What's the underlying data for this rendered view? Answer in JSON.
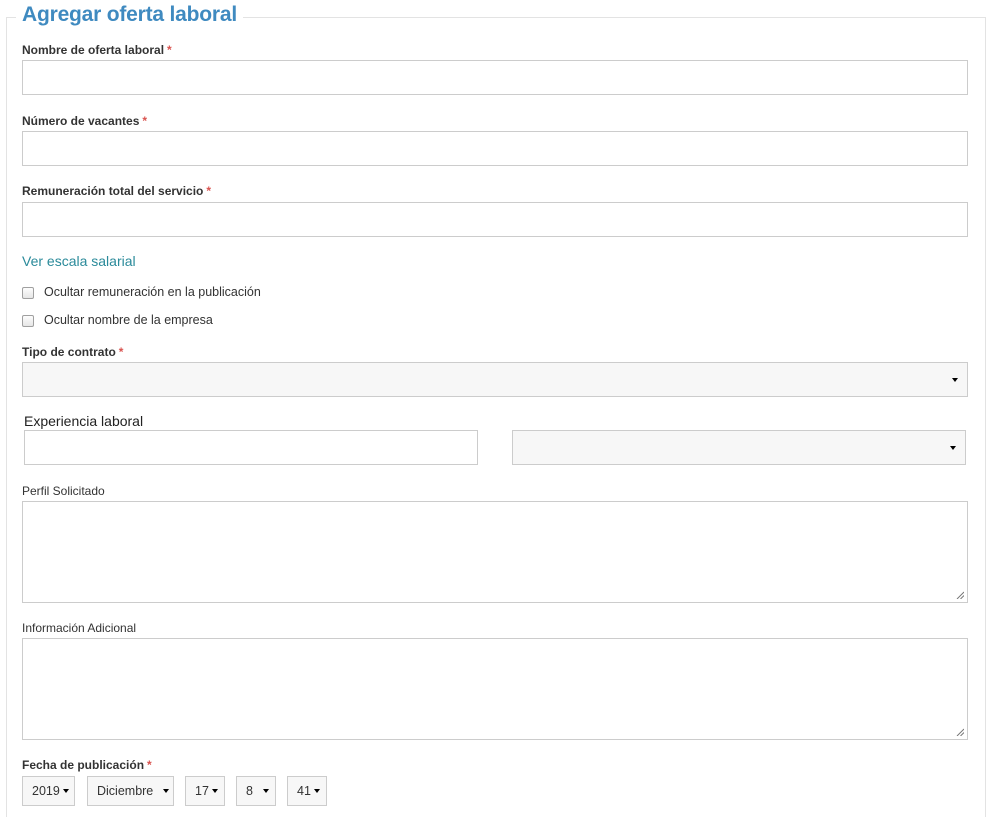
{
  "form": {
    "title": "Agregar oferta laboral",
    "required_marker": "*",
    "fields": {
      "nombre_label": "Nombre de oferta laboral",
      "nombre_value": "",
      "vacantes_label": "Número de vacantes",
      "vacantes_value": "",
      "remuneracion_label": "Remuneración total del servicio",
      "remuneracion_value": "",
      "escala_link": "Ver escala salarial",
      "ocultar_remuneracion_label": "Ocultar remuneración en la publicación",
      "ocultar_remuneracion_checked": false,
      "ocultar_empresa_label": "Ocultar nombre de la empresa",
      "ocultar_empresa_checked": false,
      "tipo_contrato_label": "Tipo de contrato",
      "tipo_contrato_value": "",
      "experiencia_label": "Experiencia laboral",
      "experiencia_value": "",
      "experiencia_unit_value": "",
      "perfil_label": "Perfil Solicitado",
      "perfil_value": "",
      "info_label": "Información Adicional",
      "info_value": "",
      "fecha_label": "Fecha de publicación",
      "fecha": {
        "year": "2019",
        "month": "Diciembre",
        "day": "17",
        "hour": "8",
        "minute": "41"
      }
    }
  },
  "icons": {
    "dropdown": "caret-down-icon",
    "resize": "resize-grip-icon"
  },
  "colors": {
    "title": "#3f8ac0",
    "link": "#2a8a9a",
    "required": "#d9534f",
    "border": "#cccccc"
  }
}
